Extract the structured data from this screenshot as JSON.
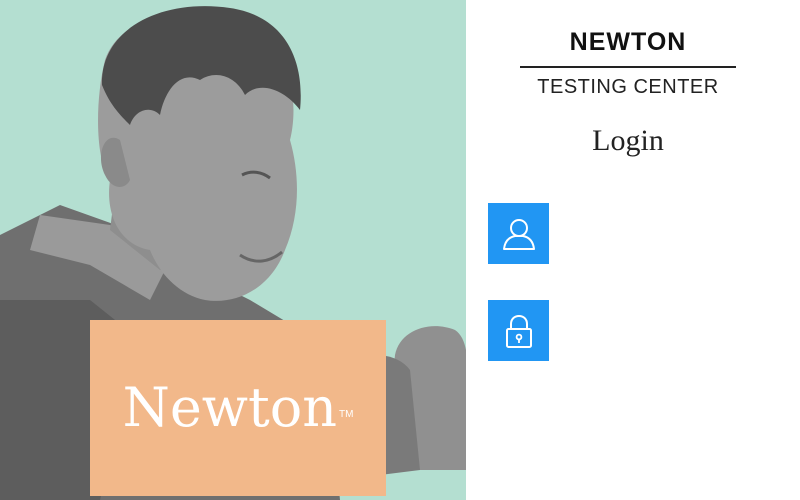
{
  "header": {
    "title": "NEWTON",
    "subtitle": "TESTING CENTER",
    "login_label": "Login"
  },
  "hero": {
    "brand_name": "Newton",
    "trademark": "TM",
    "background_color": "#b4dfd1",
    "brand_box_color": "#f2b88a"
  },
  "form": {
    "username_icon": "user-icon",
    "password_icon": "lock-icon",
    "username_value": "",
    "password_value": "",
    "accent_color": "#2196f3"
  }
}
